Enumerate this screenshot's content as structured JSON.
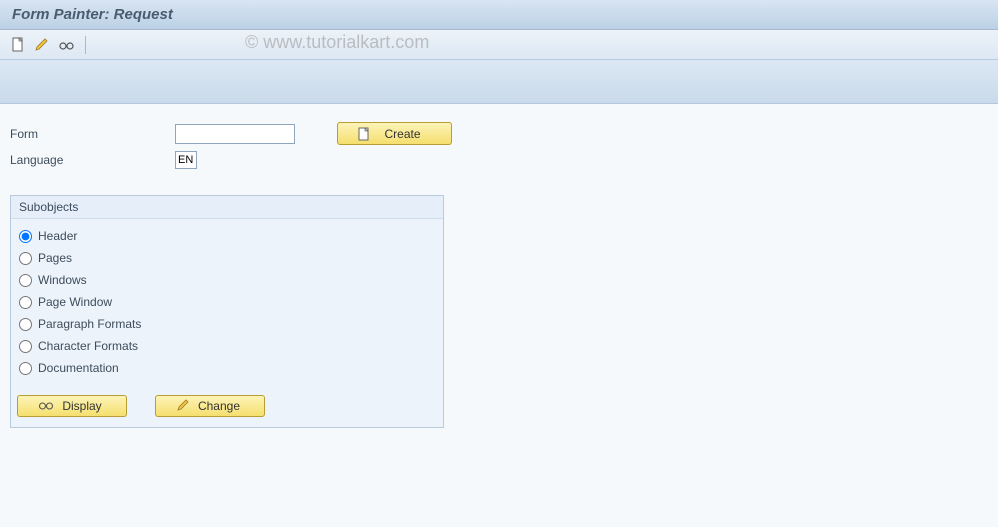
{
  "title": "Form Painter: Request",
  "watermark": "© www.tutorialkart.com",
  "fields": {
    "form_label": "Form",
    "form_value": "",
    "language_label": "Language",
    "language_value": "EN"
  },
  "buttons": {
    "create": "Create",
    "display": "Display",
    "change": "Change"
  },
  "groupbox": {
    "title": "Subobjects",
    "options": [
      {
        "label": "Header",
        "selected": true
      },
      {
        "label": "Pages",
        "selected": false
      },
      {
        "label": "Windows",
        "selected": false
      },
      {
        "label": "Page Window",
        "selected": false
      },
      {
        "label": "Paragraph Formats",
        "selected": false
      },
      {
        "label": "Character Formats",
        "selected": false
      },
      {
        "label": "Documentation",
        "selected": false
      }
    ]
  }
}
